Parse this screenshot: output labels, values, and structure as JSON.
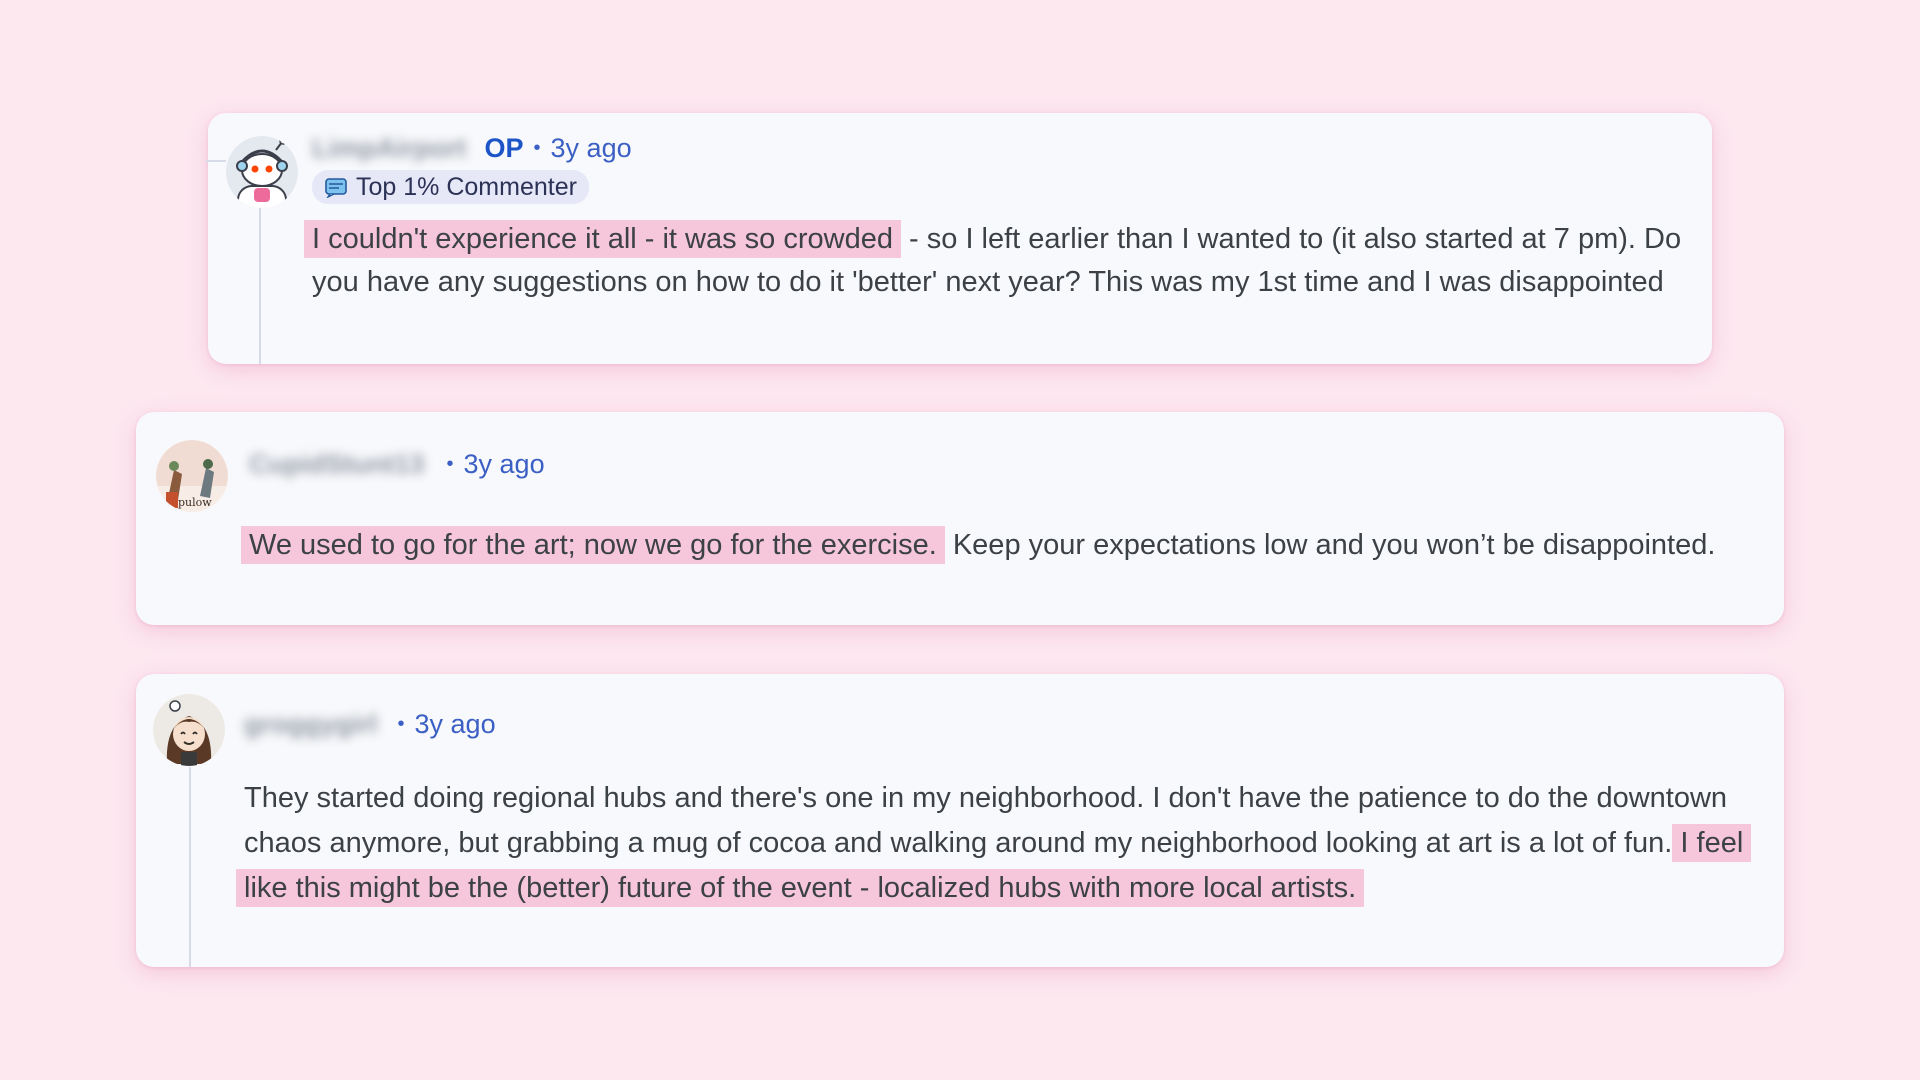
{
  "comments": [
    {
      "username": "LimpAirport",
      "op_badge": "OP",
      "separator": "•",
      "time": "3y ago",
      "flair": "Top 1% Commenter",
      "body_highlight": "I couldn't experience it all - it was so crowded",
      "body_rest": " - so I left earlier than I wanted to (it also started at 7 pm). Do you have any suggestions on how to do it 'better' next year? This was my 1st time and I was disappointed",
      "avatar": "robot-avatar-icon"
    },
    {
      "username": "CupidStunt13",
      "separator": "•",
      "time": "3y ago",
      "body_highlight": "We used to go for the art; now we go for the exercise.",
      "body_rest": " Keep your expectations low and you won’t be disappointed.",
      "avatar": "figures-avatar-icon"
    },
    {
      "username": "groggygirl",
      "separator": "•",
      "time": "3y ago",
      "body_plain": "They started doing regional hubs and there's one in my neighborhood. I don't have the patience to do the downtown chaos anymore, but grabbing a mug of cocoa and walking around my neighborhood looking at art is a lot of fun. ",
      "body_highlight": "I feel like this might be the (better) future of the event - localized hubs with more local artists.",
      "avatar": "girl-avatar-icon"
    }
  ],
  "colors": {
    "background": "#fde8f0",
    "card": "#f8f9fc",
    "highlight": "#f6c6da",
    "time_blue": "#3b5fc4",
    "op_blue": "#1d55c9"
  }
}
